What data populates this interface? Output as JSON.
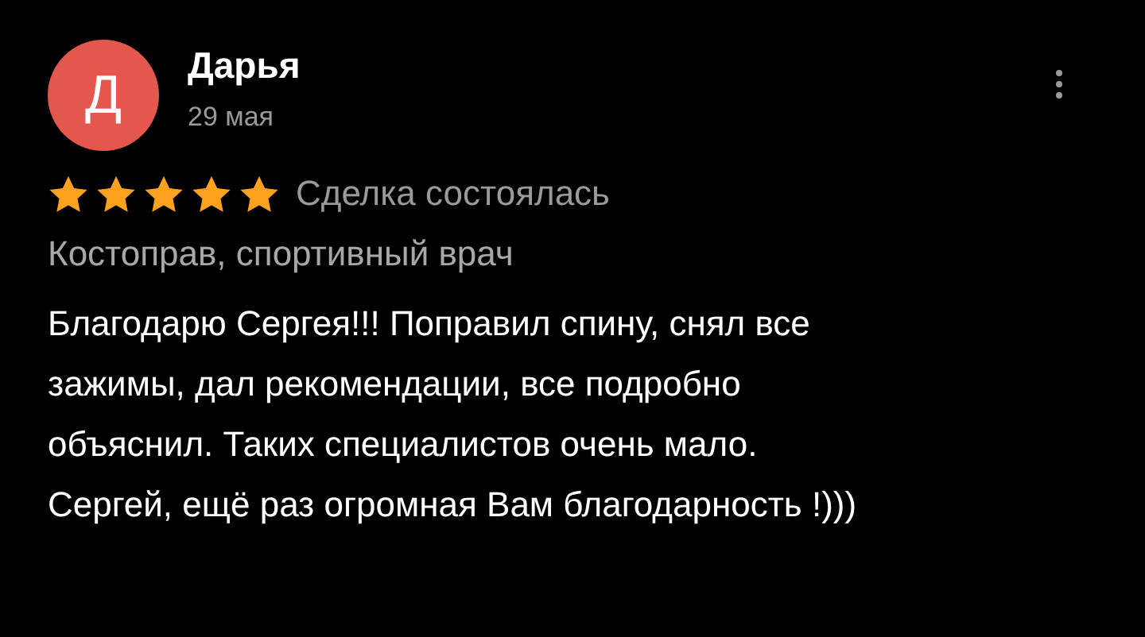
{
  "review": {
    "avatar_letter": "Д",
    "author": "Дарья",
    "date": "29 мая",
    "stars": 5,
    "deal_status": "Сделка состоялась",
    "service": "Костоправ, спортивный врач",
    "text": "Благодарю Сергея!!! Поправил спину, снял все зажимы, дал рекомендации, все подробно объяснил. Таких специалистов очень мало. Сергей, ещё раз огромная Вам благодарность !)))"
  }
}
